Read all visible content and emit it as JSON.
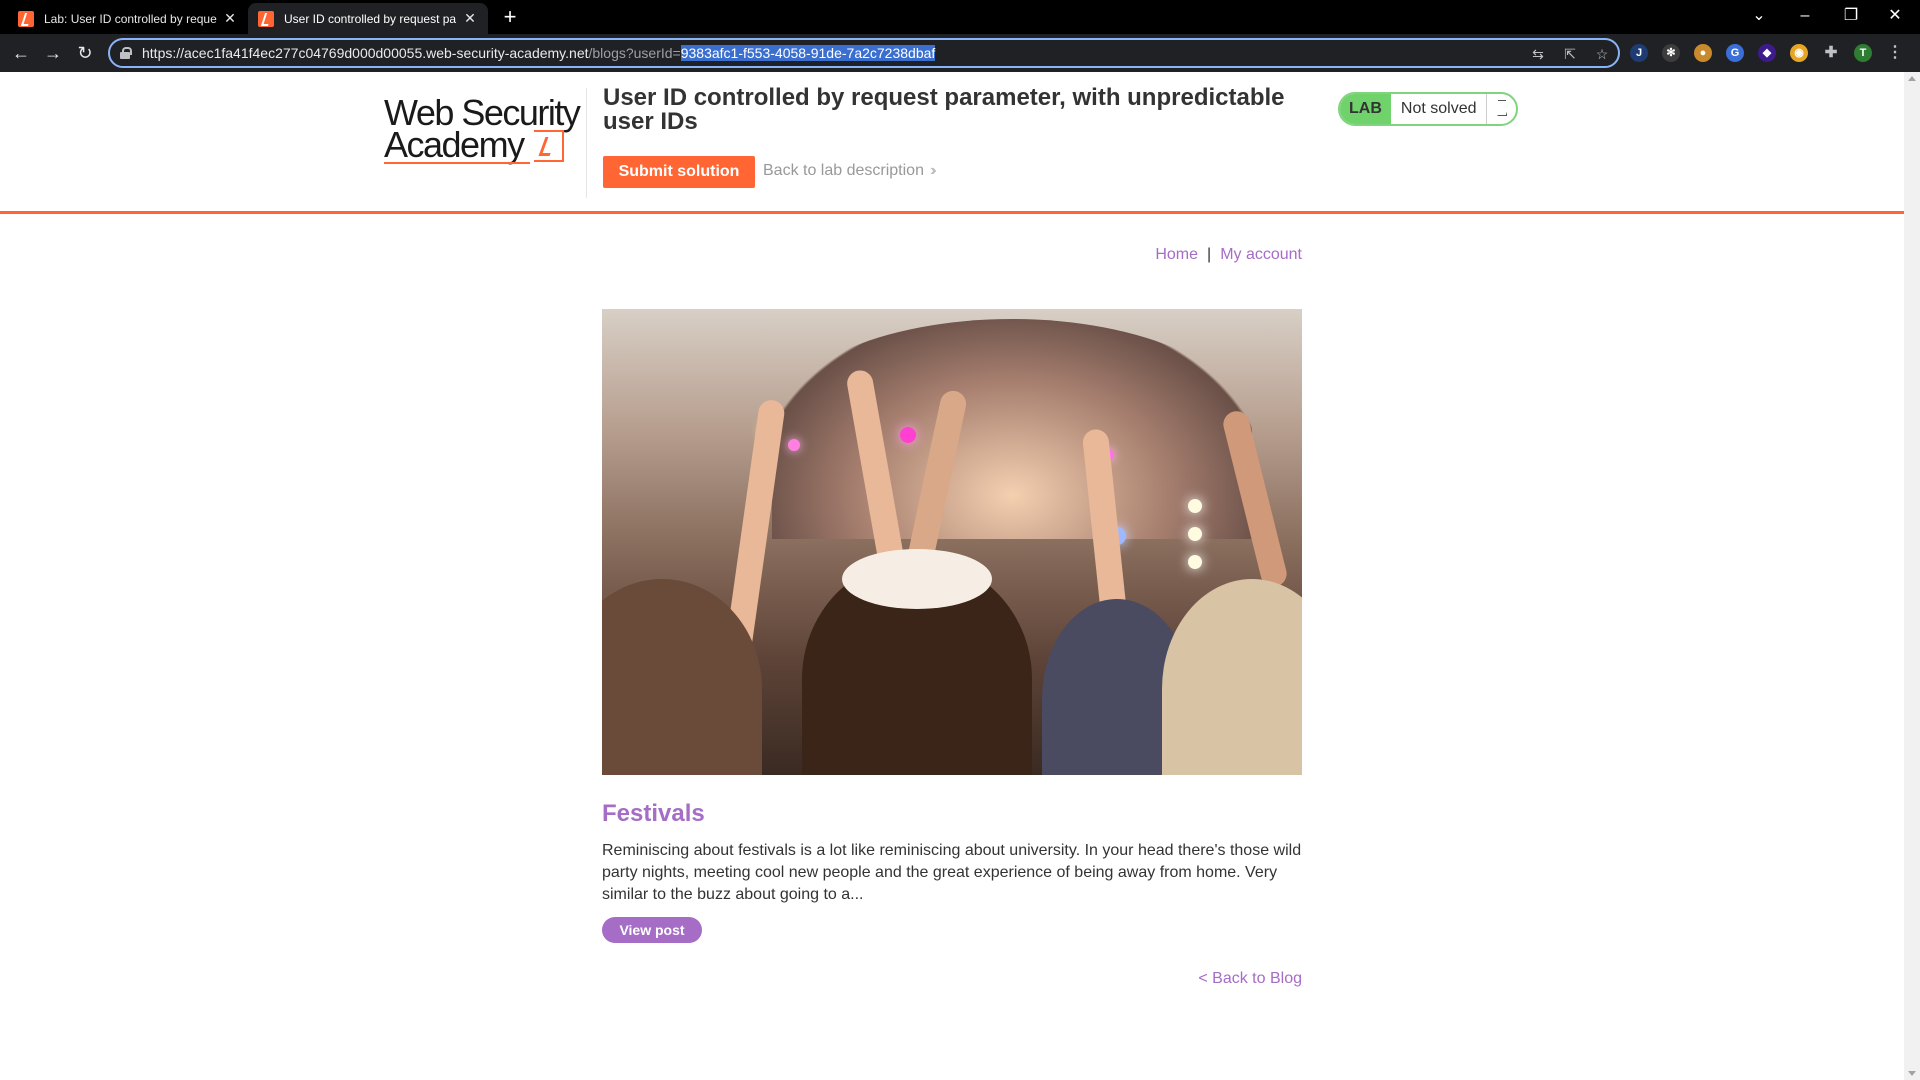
{
  "browser": {
    "tabs": [
      {
        "title": "Lab: User ID controlled by reque",
        "active": false
      },
      {
        "title": "User ID controlled by request pa",
        "active": true
      }
    ],
    "url": {
      "host": "https://acec1fa41f4ec277c04769d000d00055.web-security-academy.net",
      "path": "/blogs?userId=",
      "selected": "9383afc1-f553-4058-91de-7a2c7238dbaf"
    }
  },
  "header": {
    "logo_line1": "Web Security",
    "logo_line2": "Academy",
    "lab_title": "User ID controlled by request parameter, with unpredictable user IDs",
    "submit_label": "Submit solution",
    "back_description": "Back to lab description",
    "lab_tag": "LAB",
    "lab_status": "Not solved"
  },
  "nav": {
    "home": "Home",
    "separator": "|",
    "account": "My account"
  },
  "post": {
    "title": "Festivals",
    "summary": "Reminiscing about festivals is a lot like reminiscing about university. In your head there's those wild party nights, meeting cool new people and the great experience of being away from home. Very similar to the buzz about going to a...",
    "view_label": "View post",
    "back_label": "< Back to Blog"
  },
  "colors": {
    "accent_orange": "#ff6633",
    "link_purple": "#a56dc5",
    "lab_green": "#70d26b"
  }
}
